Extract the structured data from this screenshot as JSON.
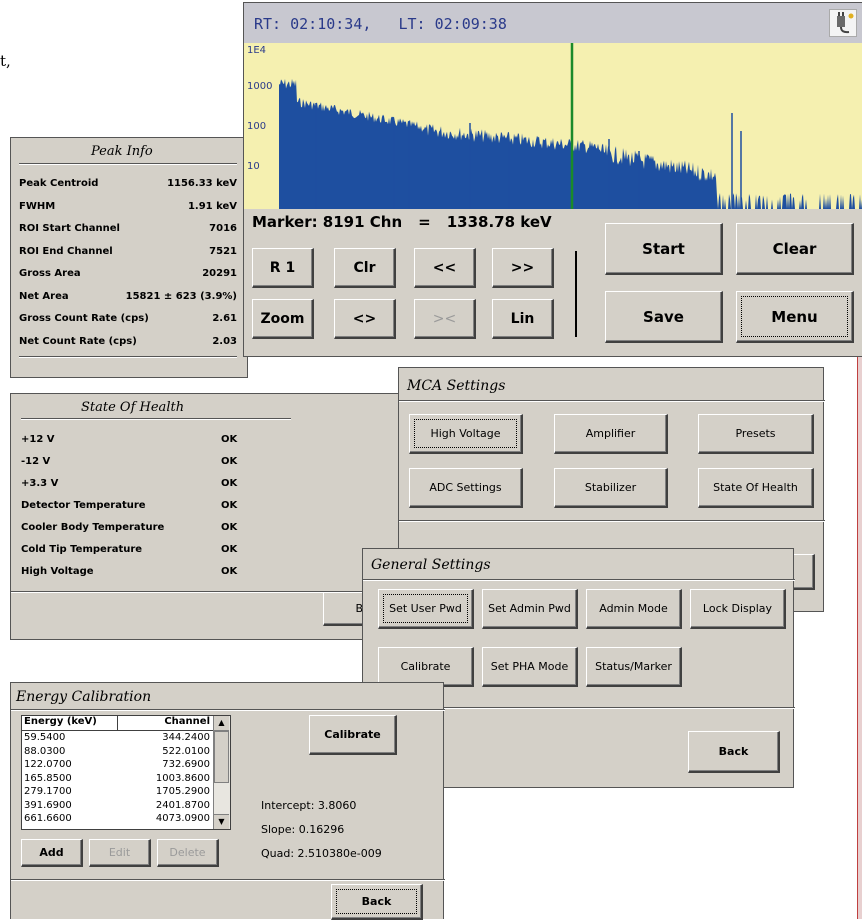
{
  "soh": {
    "title": "State Of Health",
    "rows": [
      {
        "label": "+12 V",
        "status": "OK"
      },
      {
        "label": "-12 V",
        "status": "OK"
      },
      {
        "label": "+3.3 V",
        "status": "OK"
      },
      {
        "label": "Detector Temperature",
        "status": "OK"
      },
      {
        "label": "Cooler Body Temperature",
        "status": "OK"
      },
      {
        "label": "Cold Tip Temperature",
        "status": "OK"
      },
      {
        "label": "High Voltage",
        "status": "OK"
      }
    ],
    "partial_button": "B"
  },
  "peak": {
    "title": "Peak Info",
    "rows": [
      {
        "label": "Peak Centroid",
        "value": "1156.33 keV"
      },
      {
        "label": "FWHM",
        "value": "1.91 keV"
      },
      {
        "label": "ROI Start Channel",
        "value": "7016"
      },
      {
        "label": "ROI End Channel",
        "value": "7521"
      },
      {
        "label": "Gross Area",
        "value": "20291"
      },
      {
        "label": "Net Area",
        "value": "15821 ± 623 (3.9%)"
      },
      {
        "label": "Gross Count Rate (cps)",
        "value": "2.61"
      },
      {
        "label": "Net Count Rate (cps)",
        "value": "2.03"
      }
    ]
  },
  "background_fragment": "t,",
  "mca": {
    "title": "MCA Settings",
    "buttons": {
      "high_voltage": "High Voltage",
      "amplifier": "Amplifier",
      "presets": "Presets",
      "adc_settings": "ADC Settings",
      "stabilizer": "Stabilizer",
      "state_of_health": "State Of Health"
    }
  },
  "general": {
    "title": "General Settings",
    "buttons": {
      "set_user_pwd": "Set User Pwd",
      "set_admin_pwd": "Set Admin Pwd",
      "admin_mode": "Admin Mode",
      "lock_display": "Lock Display",
      "calibrate": "Calibrate",
      "set_pha_mode": "Set PHA Mode",
      "status_marker": "Status/Marker",
      "back": "Back"
    }
  },
  "energy": {
    "title": "Energy Calibration",
    "col_energy": "Energy (keV)",
    "col_channel": "Channel",
    "rows": [
      {
        "energy": "59.5400",
        "channel": "344.2400"
      },
      {
        "energy": "88.0300",
        "channel": "522.0100"
      },
      {
        "energy": "122.0700",
        "channel": "732.6900"
      },
      {
        "energy": "165.8500",
        "channel": "1003.8600"
      },
      {
        "energy": "279.1700",
        "channel": "1705.2900"
      },
      {
        "energy": "391.6900",
        "channel": "2401.8700"
      },
      {
        "energy": "661.6600",
        "channel": "4073.0900"
      }
    ],
    "calibrate": "Calibrate",
    "intercept": "Intercept: 3.8060",
    "slope": "Slope: 0.16296",
    "quad": "Quad: 2.510380e-009",
    "add": "Add",
    "edit": "Edit",
    "delete": "Delete",
    "back": "Back"
  },
  "spectrum": {
    "times": "RT: 02:10:34,   LT: 02:09:38",
    "yticks": [
      "1E4",
      "1000",
      "100",
      "10"
    ],
    "marker_label": "Marker: 8191 Chn",
    "equals": "=",
    "marker_energy": "1338.78 keV",
    "buttons": {
      "r1": "R 1",
      "clr": "Clr",
      "prev": "<<",
      "next": ">>",
      "zoom": "Zoom",
      "expand": "<>",
      "shrink": "><",
      "lin": "Lin",
      "start": "Start",
      "clear": "Clear",
      "save": "Save",
      "menu": "Menu"
    },
    "plot_bg": "#f5f0b0",
    "bar_color": "#1e4fa0",
    "marker_color": "#1a8a2a",
    "scale": "log"
  }
}
